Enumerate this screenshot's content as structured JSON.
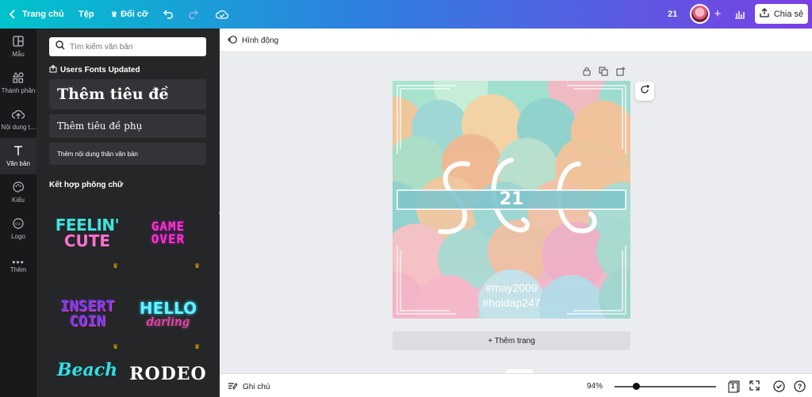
{
  "topbar": {
    "home_label": "Trang chủ",
    "file_label": "Tệp",
    "resize_label": "Đổi cỡ",
    "page_number": "21",
    "share_label": "Chia sẻ"
  },
  "rail": {
    "items": [
      {
        "label": "Mẫu",
        "icon": "layout-icon"
      },
      {
        "label": "Thành phần",
        "icon": "shapes-icon"
      },
      {
        "label": "Nội dung t...",
        "icon": "upload-cloud-icon"
      },
      {
        "label": "Văn bản",
        "icon": "text-icon"
      },
      {
        "label": "Kiểu",
        "icon": "palette-icon"
      },
      {
        "label": "Logo",
        "icon": "logo-icon"
      },
      {
        "label": "Thêm",
        "icon": "more-icon"
      }
    ]
  },
  "panel": {
    "search_placeholder": "Tìm kiếm văn bản",
    "fonts_updated": "Users Fonts Updated",
    "heading_label": "Thêm tiêu đề",
    "subheading_label": "Thêm tiêu đề phụ",
    "body_label": "Thêm nội dung thân văn bản",
    "combo_title": "Kết hợp phông chữ",
    "combos": [
      {
        "line1": "FEELIN'",
        "line2": "CUTE"
      },
      {
        "line1": "GAME",
        "line2": "OVER"
      },
      {
        "line1": "INSERT",
        "line2": "COIN"
      },
      {
        "line1": "HELLO",
        "line2": "darling"
      },
      {
        "line1": "Beach",
        "line2": ""
      },
      {
        "line1": "RODEO",
        "line2": ""
      }
    ]
  },
  "subbar": {
    "animate_label": "Hình động"
  },
  "design": {
    "number": "21",
    "hashtag1": "#may2009",
    "hashtag2": "#hoidap247"
  },
  "canvas": {
    "add_page_label": "+ Thêm trang"
  },
  "bottombar": {
    "notes_label": "Ghi chú",
    "zoom_label": "94%",
    "zoom_fraction": 0.94,
    "page_count": "1"
  },
  "colors": {
    "brand_gradient_start": "#00c4cc",
    "brand_gradient_end": "#7b3fe4",
    "rail_bg": "#18191b",
    "panel_bg": "#252627"
  }
}
